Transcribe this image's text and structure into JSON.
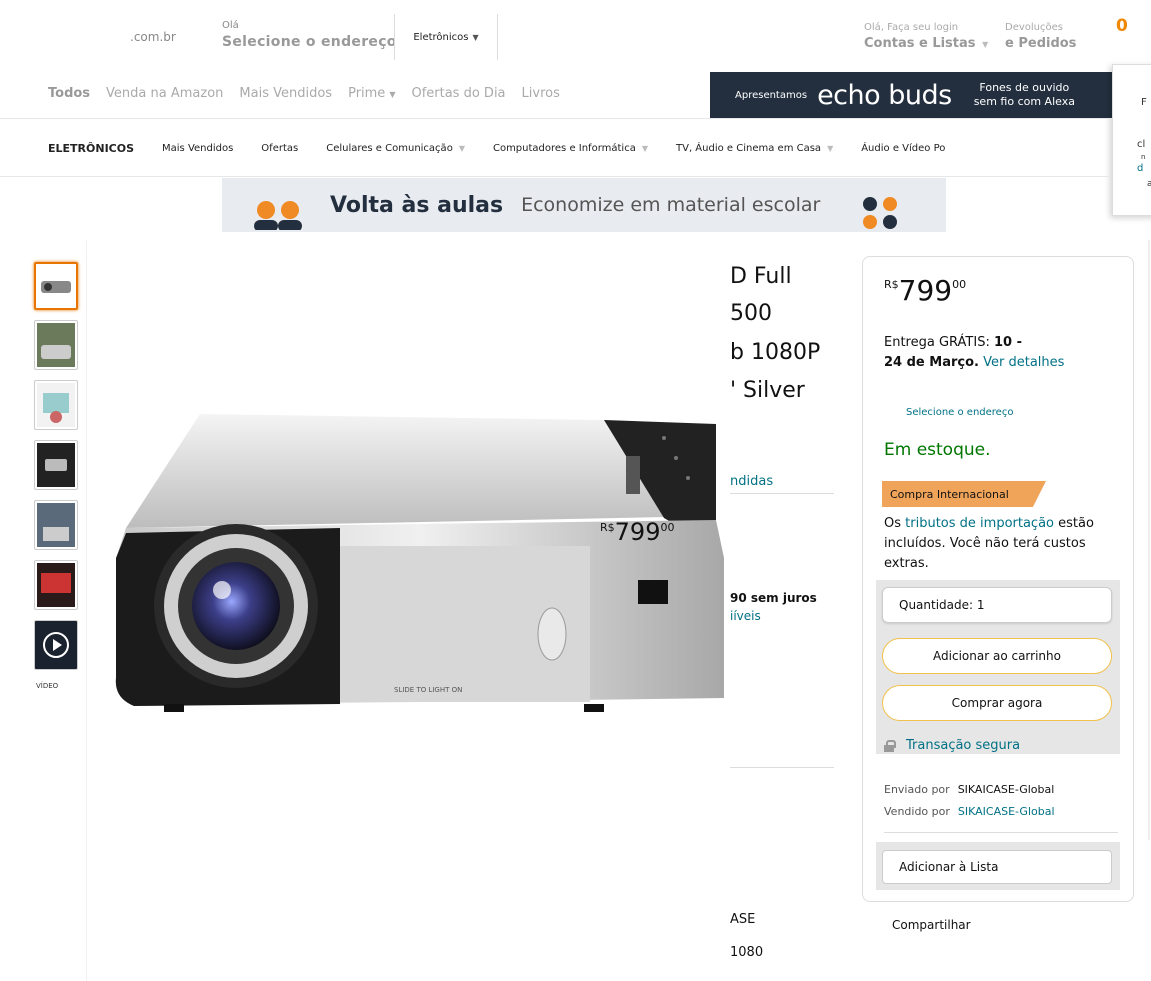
{
  "header": {
    "logo_suffix": ".com.br",
    "address_hello": "Olá",
    "address_select": "Selecione o endereço",
    "search_dept": "Eletrônicos",
    "account_hello": "Olá, Faça seu login",
    "account_lists": "Contas e Listas",
    "returns_top": "Devoluções",
    "returns_bottom": "e Pedidos",
    "cart_count": "0"
  },
  "nav": {
    "all": "Todos",
    "items": [
      "Venda na Amazon",
      "Mais Vendidos",
      "Prime",
      "Ofertas do Dia",
      "Livros"
    ]
  },
  "echo_banner": {
    "intro": "Apresentamos",
    "brand": "echo buds",
    "desc_line1": "Fones de ouvido",
    "desc_line2": "sem fio com Alexa"
  },
  "side_popup": {
    "line1": "F",
    "line2": "cl",
    "line3": "n",
    "line4": "d",
    "line5": "a"
  },
  "subnav": {
    "main": "ELETRÔNICOS",
    "items": [
      "Mais Vendidos",
      "Ofertas",
      "Celulares e Comunicação",
      "Computadores e Informática",
      "TV, Áudio e Cinema em Casa",
      "Áudio e Vídeo Po"
    ]
  },
  "promo": {
    "title": "Volta às aulas",
    "subtitle": "Economize em material escolar"
  },
  "thumbnails": {
    "video_label": "VÍDEO"
  },
  "product": {
    "title_line1": "D Full",
    "title_line2": "500",
    "title_line3": "b 1080P",
    "title_line4": "' Silver",
    "sold": "ndidas",
    "installments": "90 sem juros",
    "installments_link": "iíveis",
    "brand_partial": "ASE",
    "resolution_partial": "1080",
    "image_text": "SLIDE TO LIGHT ON",
    "overlay_price_currency": "R$",
    "overlay_price_int": "799",
    "overlay_price_frac": "00"
  },
  "buybox": {
    "currency": "R$",
    "price_int": "799",
    "price_frac": "00",
    "delivery_prefix": "Entrega GRÁTIS:",
    "delivery_dates_1": "10 -",
    "delivery_dates_2": "24 de Março.",
    "delivery_link": "Ver detalhes",
    "select_address": "Selecione o endereço",
    "stock": "Em estoque.",
    "badge": "Compra Internacional",
    "tax_prefix": "Os",
    "tax_link": "tributos de importação",
    "tax_rest": "estão incluídos. Você não terá custos extras.",
    "quantity": "Quantidade: 1",
    "add_to_cart": "Adicionar ao carrinho",
    "buy_now": "Comprar agora",
    "secure": "Transação segura",
    "shipped_by_label": "Enviado por",
    "shipped_by": "SIKAICASE-Global",
    "sold_by_label": "Vendido por",
    "sold_by": "SIKAICASE-Global",
    "add_to_list": "Adicionar à Lista",
    "share": "Compartilhar"
  },
  "colors": {
    "link": "#007185",
    "stock_green": "#007600",
    "cart_orange": "#f08804",
    "badge": "#f0a45a",
    "button_border": "#f0c14b",
    "banner_dark": "#232f3e"
  }
}
